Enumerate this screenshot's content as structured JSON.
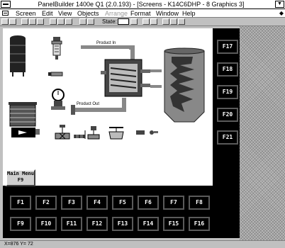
{
  "window": {
    "title": "PanelBuilder 1400e  Q1 (2.0.193) - [Screens - K14C6DHP -  8 Graphics 3]",
    "dropdown_glyph": "▼"
  },
  "menu": {
    "items": [
      "Screen",
      "Edit",
      "View",
      "Objects",
      "Arrange",
      "Format",
      "Window",
      "Help"
    ],
    "right_arrow": "◆"
  },
  "toolbar": {
    "state_label": "State:",
    "state_value": ""
  },
  "process": {
    "product_in": "Product In",
    "product_out": "Product Out"
  },
  "main_menu_button": {
    "line1": "Main Menu",
    "line2": "F9"
  },
  "right_keys": [
    "F17",
    "F18",
    "F19",
    "F20",
    "F21"
  ],
  "bottom_keys_row1": [
    "F1",
    "F2",
    "F3",
    "F4",
    "F5",
    "F6",
    "F7",
    "F8"
  ],
  "bottom_keys_row2": [
    "F9",
    "F10",
    "F11",
    "F12",
    "F13",
    "F14",
    "F15",
    "F16"
  ],
  "status": {
    "coords": "X=876 Y= 72"
  },
  "colors": {
    "panel_black": "#000000",
    "canvas_white": "#ffffff",
    "chrome_gray": "#c0c0c0"
  }
}
